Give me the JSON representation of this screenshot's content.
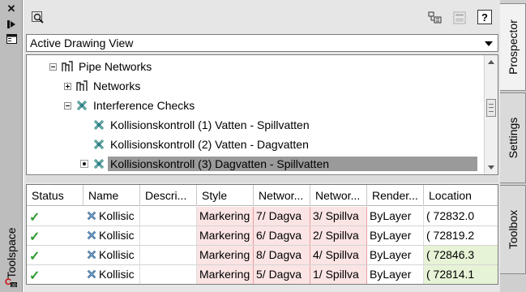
{
  "window": {
    "side_title": "Toolspace",
    "close_glyph": "✕"
  },
  "toolbar": {
    "icons": [
      "find-icon",
      "item-view-icon",
      "panel-toggle-icon",
      "help-icon"
    ],
    "help_label": "?"
  },
  "view_select": {
    "value": "Active Drawing View"
  },
  "tree": {
    "items": [
      {
        "label": "Pipe Networks",
        "icon": "pipe-network-icon",
        "expander": "minus"
      },
      {
        "label": "Networks",
        "icon": "pipe-network-icon",
        "expander": "plus"
      },
      {
        "label": "Interference Checks",
        "icon": "interference-check-icon",
        "expander": "minus"
      },
      {
        "label": "Kollisionskontroll (1) Vatten - Spillvatten",
        "icon": "interference-check-icon",
        "expander": ""
      },
      {
        "label": "Kollisionskontroll (2) Vatten - Dagvatten",
        "icon": "interference-check-icon",
        "expander": ""
      },
      {
        "label": "Kollisionskontroll (3) Dagvatten - Spillvatten",
        "icon": "interference-check-icon",
        "expander": "",
        "selected": true
      }
    ]
  },
  "grid": {
    "columns": [
      "Status",
      "Name",
      "Descri...",
      "Style",
      "Networ...",
      "Networ...",
      "Render...",
      "Location"
    ],
    "rows": [
      {
        "status": "✓",
        "name": "Kollisic",
        "description": "",
        "style": "Markering",
        "network1": "7/ Dagva",
        "network2": "3/ Spillva",
        "render": "ByLayer",
        "location": "( 72832.0"
      },
      {
        "status": "✓",
        "name": "Kollisic",
        "description": "",
        "style": "Markering",
        "network1": "6/ Dagva",
        "network2": "2/ Spillva",
        "render": "ByLayer",
        "location": "( 72819.2"
      },
      {
        "status": "✓",
        "name": "Kollisic",
        "description": "",
        "style": "Markering",
        "network1": "8/ Dagva",
        "network2": "4/ Spillva",
        "render": "ByLayer",
        "location": "( 72846.3"
      },
      {
        "status": "✓",
        "name": "Kollisic",
        "description": "",
        "style": "Markering",
        "network1": "5/ Dagva",
        "network2": "1/ Spillva",
        "render": "ByLayer",
        "location": "( 72814.1"
      }
    ]
  },
  "tabs": [
    {
      "label": "Prospector",
      "active": true
    },
    {
      "label": "Settings",
      "active": false
    },
    {
      "label": "Toolbox",
      "active": false
    }
  ],
  "colors": {
    "check": "#2f9a2f",
    "selected_row": "#9a9a9a",
    "tinted_cell": "#fbe4e4"
  }
}
